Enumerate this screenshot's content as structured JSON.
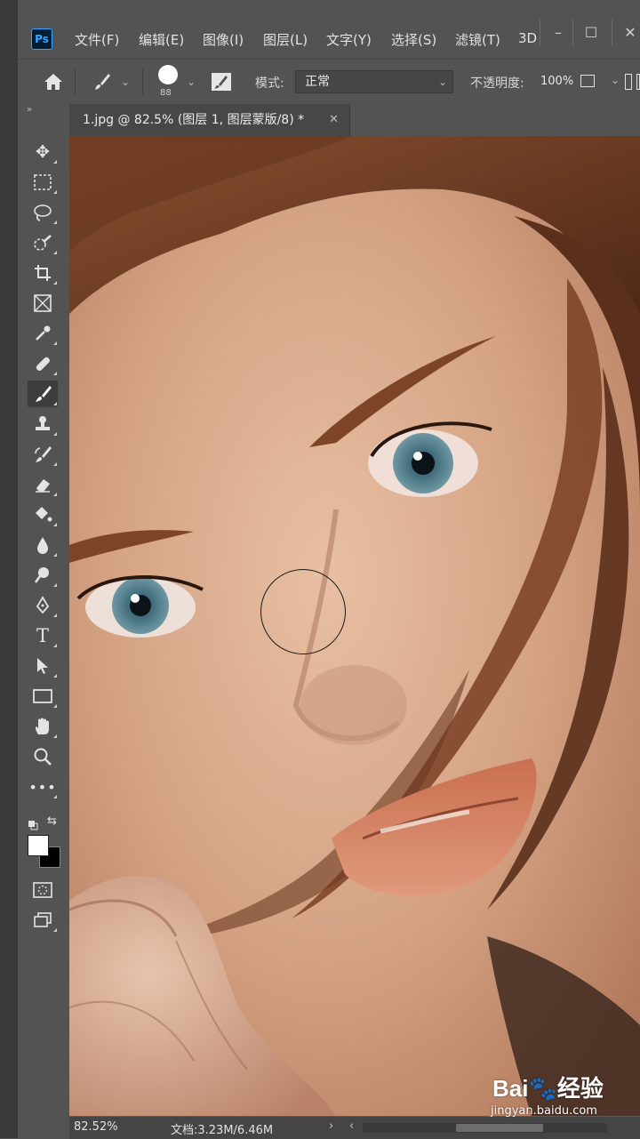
{
  "app": {
    "logo_text": "Ps"
  },
  "menu": {
    "items": [
      "文件(F)",
      "编辑(E)",
      "图像(I)",
      "图层(L)",
      "文字(Y)",
      "选择(S)",
      "滤镜(T)",
      "3D"
    ],
    "window_controls": [
      "–",
      "☐",
      "✕"
    ]
  },
  "options": {
    "brush_size": "88",
    "mode_label": "模式:",
    "mode_value": "正常",
    "opacity_label": "不透明度:",
    "opacity_value": "100%"
  },
  "document": {
    "tab_title": "1.jpg @ 82.5% (图层 1, 图层蒙版/8) *",
    "tab_close": "✕"
  },
  "toolbar": {
    "tools": [
      {
        "name": "move-tool",
        "icon": "move-icon"
      },
      {
        "name": "marquee-tool",
        "icon": "rect-marquee-icon"
      },
      {
        "name": "lasso-tool",
        "icon": "lasso-icon"
      },
      {
        "name": "quick-selection-tool",
        "icon": "quick-select-icon"
      },
      {
        "name": "crop-tool",
        "icon": "crop-icon"
      },
      {
        "name": "frame-tool",
        "icon": "frame-icon"
      },
      {
        "name": "eyedropper-tool",
        "icon": "eyedropper-icon"
      },
      {
        "name": "healing-brush-tool",
        "icon": "bandage-icon"
      },
      {
        "name": "brush-tool",
        "icon": "brush-icon",
        "active": true
      },
      {
        "name": "clone-stamp-tool",
        "icon": "stamp-icon"
      },
      {
        "name": "history-brush-tool",
        "icon": "history-brush-icon"
      },
      {
        "name": "eraser-tool",
        "icon": "eraser-icon"
      },
      {
        "name": "paint-bucket-tool",
        "icon": "bucket-icon"
      },
      {
        "name": "blur-tool",
        "icon": "drop-icon"
      },
      {
        "name": "dodge-tool",
        "icon": "dodge-icon"
      },
      {
        "name": "pen-tool",
        "icon": "pen-icon"
      },
      {
        "name": "type-tool",
        "icon": "type-icon"
      },
      {
        "name": "path-selection-tool",
        "icon": "arrow-icon"
      },
      {
        "name": "rectangle-tool",
        "icon": "rectangle-icon"
      },
      {
        "name": "hand-tool",
        "icon": "hand-icon"
      },
      {
        "name": "zoom-tool",
        "icon": "zoom-icon"
      },
      {
        "name": "more-tools",
        "icon": "ellipsis-icon"
      }
    ],
    "foreground_color": "#ffffff",
    "background_color": "#000000"
  },
  "status": {
    "zoom": "82.52%",
    "doc_info": "文档:3.23M/6.46M"
  },
  "watermark": {
    "logo_text": "Bai🐾经验",
    "url": "jingyan.baidu.com"
  },
  "colors": {
    "ui_background": "#535353",
    "panel_dark": "#3a3a3a",
    "ps_blue": "#31a8ff"
  }
}
